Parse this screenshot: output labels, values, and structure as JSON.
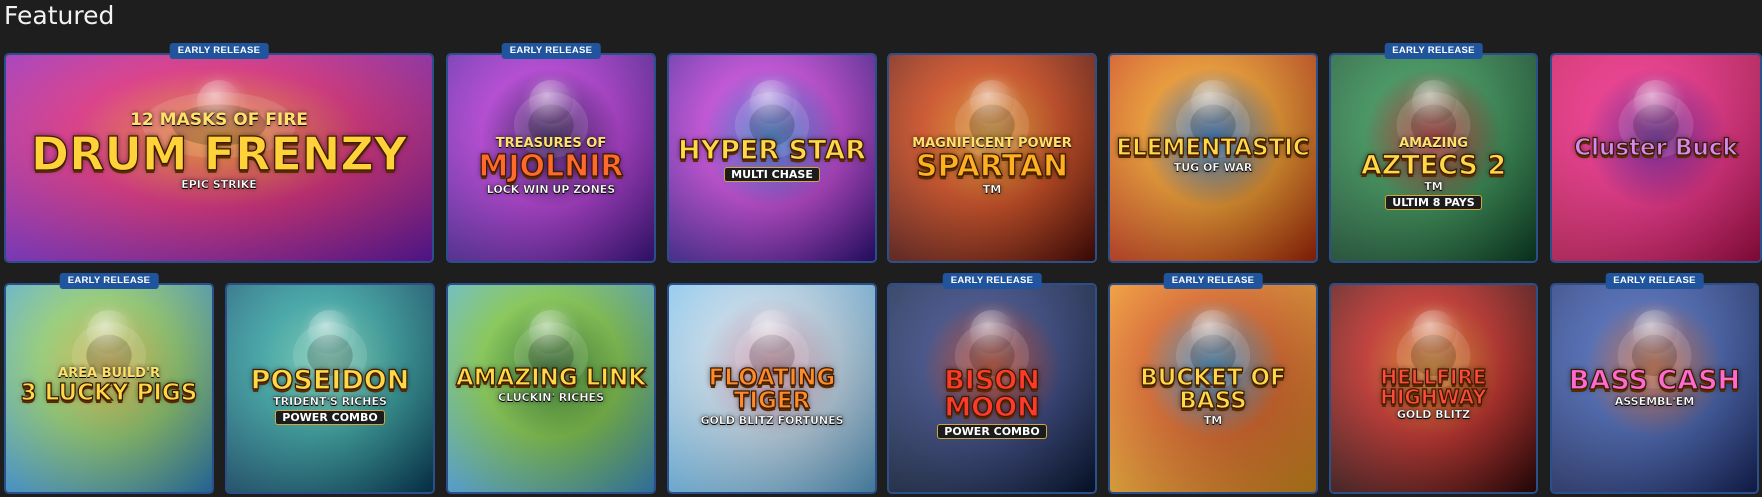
{
  "section": {
    "title": "Featured"
  },
  "badge_label": "EARLY RELEASE",
  "games": [
    {
      "pre": "12 MASKS OF FIRE",
      "main": "DRUM FRENZY",
      "sub": "EPIC STRIKE",
      "pill": "",
      "early_release": true,
      "icon": "mask-icon",
      "colors": [
        "#7a1fc4",
        "#e0207a",
        "#ff9a1a"
      ]
    },
    {
      "pre": "TREASURES OF",
      "main": "MJOLNIR",
      "sub": "LOCK WIN UP ZONES",
      "pill": "",
      "early_release": true,
      "icon": "hammer-icon",
      "colors": [
        "#4a1a9a",
        "#b02ed6",
        "#2d0a5a"
      ]
    },
    {
      "pre": "",
      "main": "HYPER STAR",
      "sub": "",
      "pill": "MULTI CHASE",
      "early_release": false,
      "icon": "star-icon",
      "colors": [
        "#3b1590",
        "#c03ad8",
        "#2a7be0"
      ]
    },
    {
      "pre": "MAGNIFICENT POWER",
      "main": "SPARTAN",
      "sub": "TM",
      "pill": "",
      "early_release": false,
      "icon": "helmet-icon",
      "colors": [
        "#5a0f08",
        "#d0400f",
        "#f2a020"
      ]
    },
    {
      "pre": "",
      "main": "ELEMENTASTIC",
      "sub": "TUG OF WAR",
      "pill": "",
      "early_release": false,
      "icon": "elements-icon",
      "colors": [
        "#c0300a",
        "#f0901a",
        "#1a70d0"
      ]
    },
    {
      "pre": "AMAZING",
      "main": "AZTECS 2",
      "sub": "TM",
      "pill": "ULTIM 8 PAYS",
      "early_release": true,
      "icon": "aztec-icon",
      "colors": [
        "#0f4a2a",
        "#2a8a4a",
        "#c02020"
      ]
    },
    {
      "pre": "",
      "main": "Cluster Buck",
      "sub": "",
      "pill": "",
      "early_release": false,
      "icon": "star-face-icon",
      "colors": [
        "#c01050",
        "#f02080",
        "#6a10a0"
      ]
    },
    {
      "pre": "AREA BUILD'R",
      "main": "3 LUCKY PIGS",
      "sub": "",
      "pill": "",
      "early_release": true,
      "icon": "pig-icon",
      "colors": [
        "#3a9ad8",
        "#8ed06a",
        "#e8c040"
      ]
    },
    {
      "pre": "",
      "main": "POSEIDON",
      "sub": "TRIDENT'S RICHES",
      "pill": "POWER COMBO",
      "early_release": false,
      "icon": "trident-icon",
      "colors": [
        "#0a4a6a",
        "#2aa0a0",
        "#7ae0c0"
      ]
    },
    {
      "pre": "",
      "main": "AMAZING LINK",
      "sub": "CLUCKIN' RICHES",
      "pill": "",
      "early_release": false,
      "icon": "chicken-icon",
      "colors": [
        "#4aa8e0",
        "#7ac840",
        "#2a7a20"
      ]
    },
    {
      "pre": "",
      "main": "FLOATING TIGER",
      "sub": "GOLD BLITZ FORTUNES",
      "pill": "",
      "early_release": false,
      "icon": "tiger-icon",
      "colors": [
        "#6ab8e8",
        "#c0dcf0",
        "#e8a0b8"
      ]
    },
    {
      "pre": "",
      "main": "BISON MOON",
      "sub": "",
      "pill": "POWER COMBO",
      "early_release": true,
      "icon": "bison-icon",
      "colors": [
        "#0a1a3a",
        "#2a3a7a",
        "#d03a1a"
      ]
    },
    {
      "pre": "",
      "main": "BUCKET OF BASS",
      "sub": "TM",
      "pill": "",
      "early_release": true,
      "icon": "fisherman-icon",
      "colors": [
        "#f0a020",
        "#e0601a",
        "#2a8ad0"
      ]
    },
    {
      "pre": "",
      "main": "HELLFIRE HIGHWAY",
      "sub": "GOLD BLITZ",
      "pill": "",
      "early_release": false,
      "icon": "car-icon",
      "colors": [
        "#3a0a0a",
        "#c0201a",
        "#f08a1a"
      ]
    },
    {
      "pre": "",
      "main": "BASS CASH",
      "sub": "ASSEMBL'EM",
      "pill": "",
      "early_release": true,
      "icon": "team-icon",
      "colors": [
        "#1a2a6a",
        "#3a5ab0",
        "#e06a3a"
      ]
    }
  ],
  "colors": {
    "background": "#1e1e1e",
    "badge": "#20559e",
    "tile_border": "#2a4f8a"
  }
}
